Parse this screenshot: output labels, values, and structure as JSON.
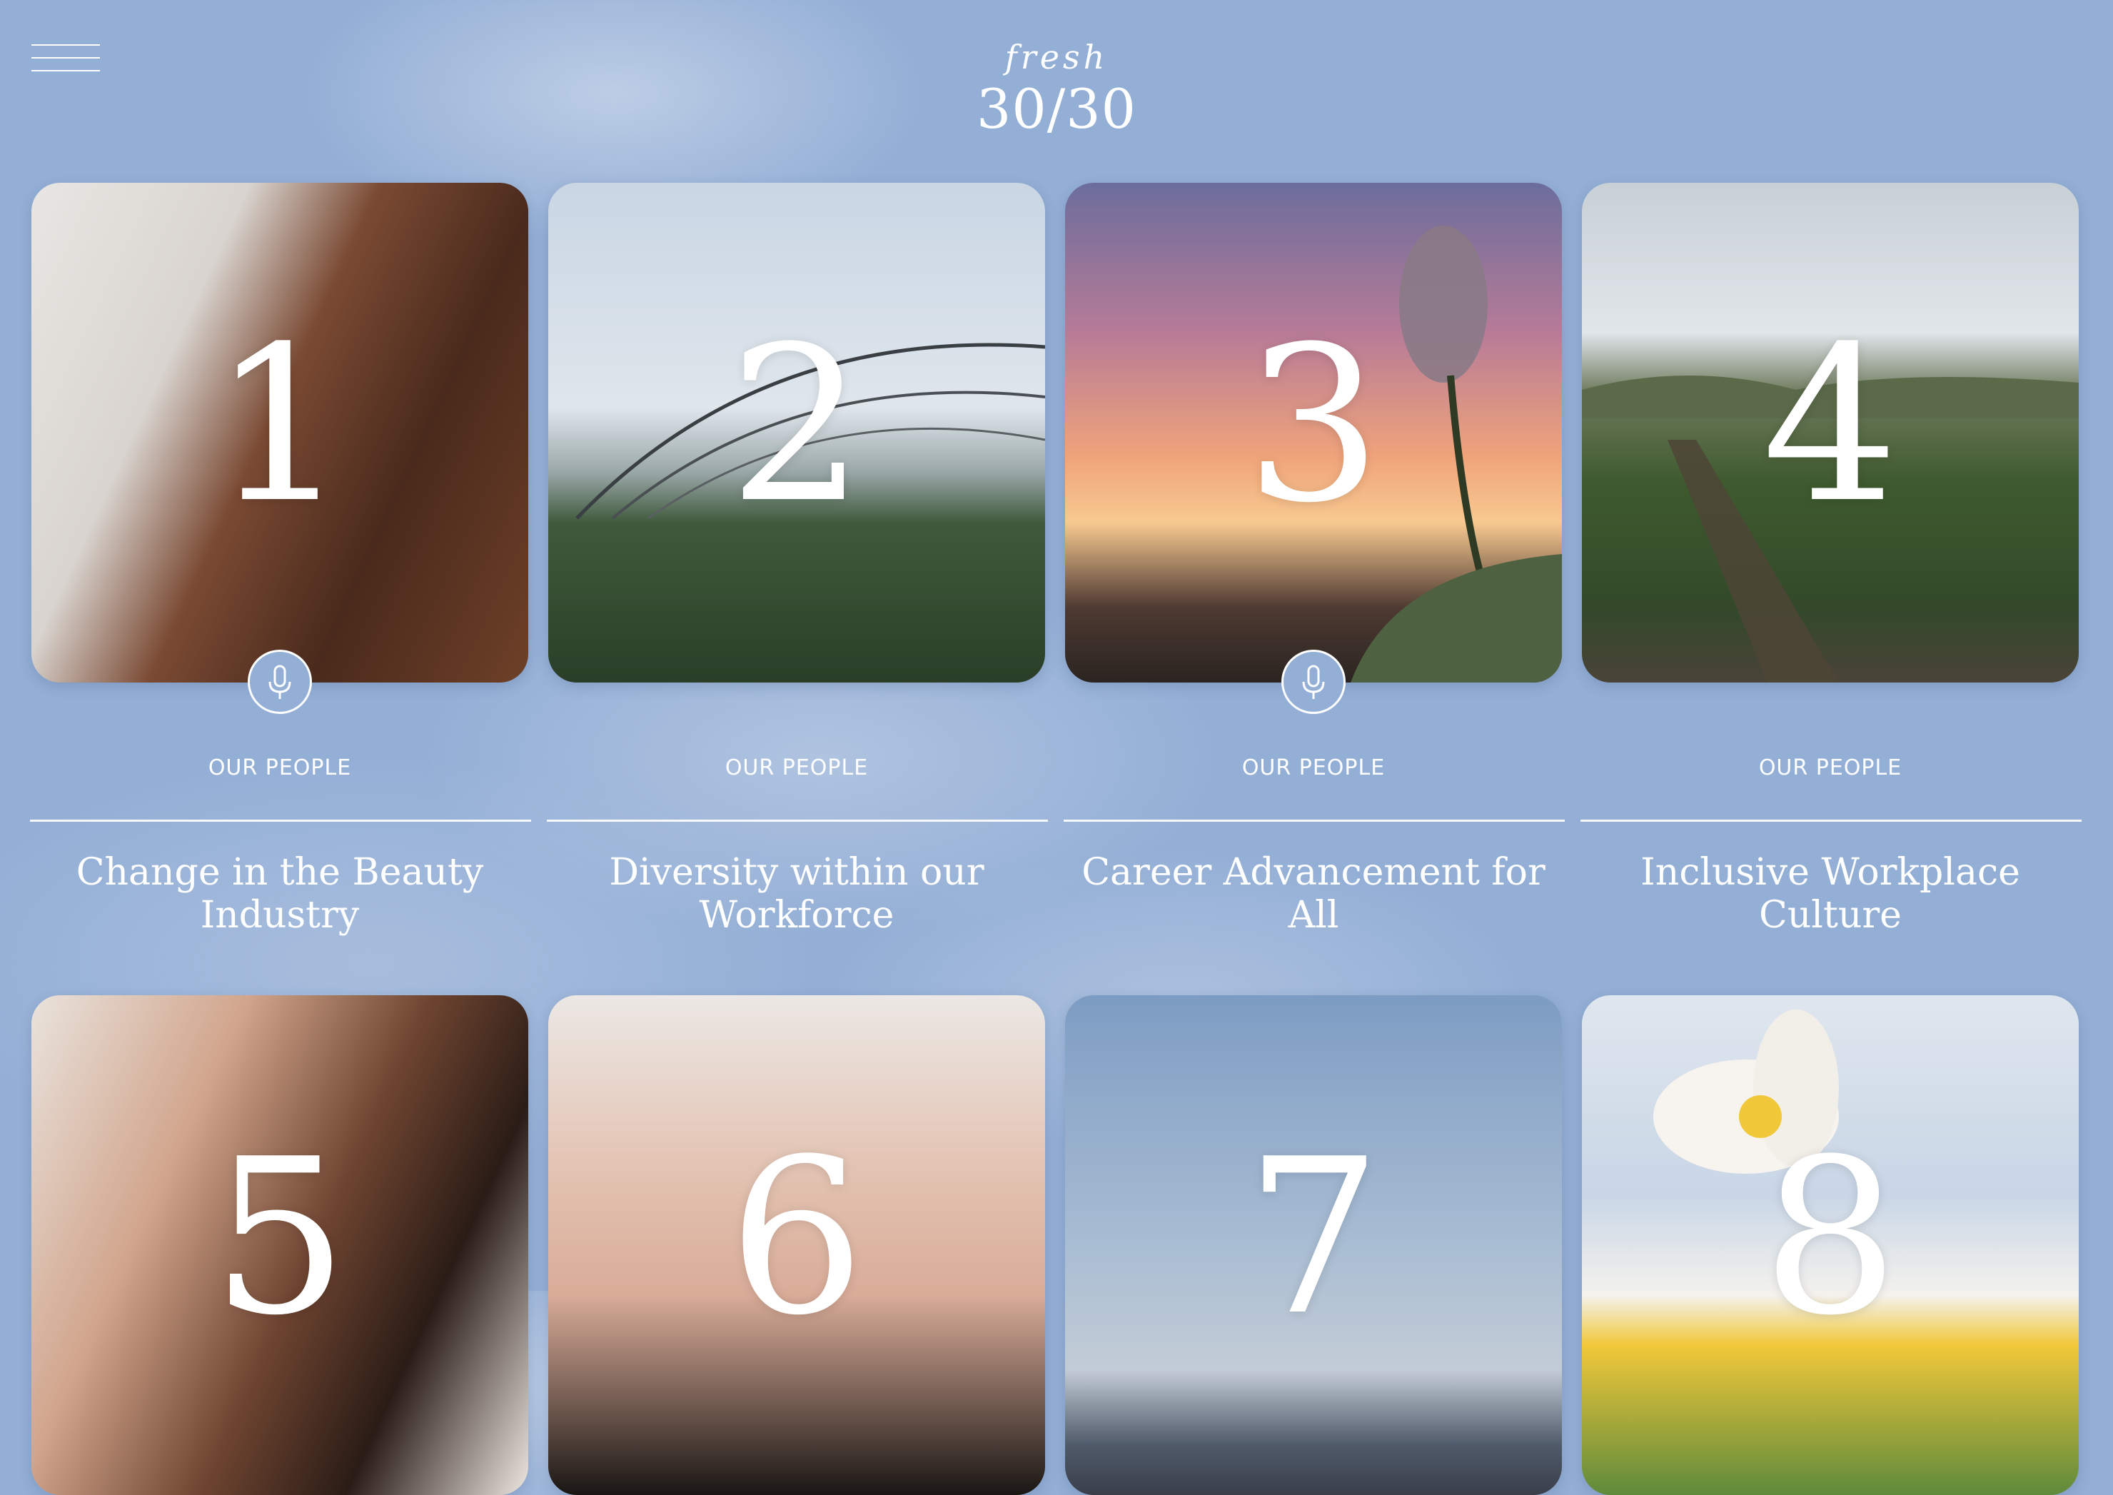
{
  "header": {
    "menu_icon": "hamburger-menu-icon",
    "brand": "fresh",
    "campaign": "30/30"
  },
  "cards": [
    {
      "number": "1",
      "category": "OUR PEOPLE",
      "title": "Change in the Beauty Industry",
      "has_audio": true,
      "audio_icon": "microphone-icon",
      "photo": "smiling woman portrait"
    },
    {
      "number": "2",
      "category": "OUR PEOPLE",
      "title": "Diversity within our Workforce",
      "has_audio": false,
      "photo": "lotus field with greenhouse hoops"
    },
    {
      "number": "3",
      "category": "OUR PEOPLE",
      "title": "Career Advancement for All",
      "has_audio": true,
      "audio_icon": "microphone-icon",
      "photo": "lotus bud at sunset"
    },
    {
      "number": "4",
      "category": "OUR PEOPLE",
      "title": "Inclusive Workplace Culture",
      "has_audio": false,
      "photo": "rose field rows"
    },
    {
      "number": "5",
      "photo": "two women portrait"
    },
    {
      "number": "6",
      "photo": "woman hand on cheek portrait"
    },
    {
      "number": "7",
      "photo": "mountain landscape sky"
    },
    {
      "number": "8",
      "photo": "white lotus flower in hand"
    }
  ]
}
